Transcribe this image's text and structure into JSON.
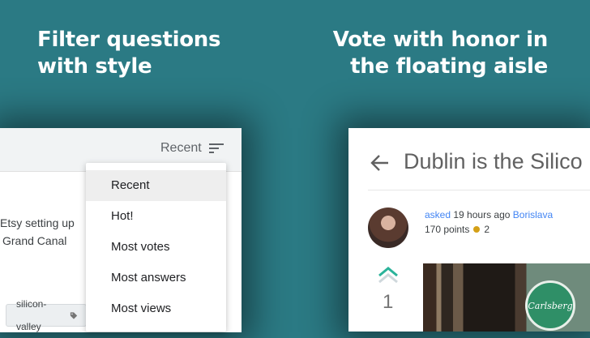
{
  "headlines": {
    "left": [
      "Filter questions",
      "with style"
    ],
    "right": [
      "Vote with honor in",
      "the floating aisle"
    ]
  },
  "filter_card": {
    "sort_label": "Recent",
    "sort_icon": "sort-icon",
    "question_lines": [
      "Etsy setting up",
      "Grand Canal"
    ],
    "tag": {
      "label": "silicon-valley",
      "icon": "tag-icon"
    },
    "dropdown": {
      "selected": "Recent",
      "options": [
        "Recent",
        "Hot!",
        "Most votes",
        "Most answers",
        "Most views"
      ]
    }
  },
  "question_card": {
    "title": "Dublin is the Silico",
    "back_icon": "arrow-back-icon",
    "asked_label": "asked",
    "asked_time": "19 hours ago",
    "author": "Borislava",
    "points": "170 points",
    "badge_count": "2",
    "vote_count": "1",
    "photo_sign_text": "Carlsberg"
  },
  "colors": {
    "background": "#2b7a84",
    "link": "#4285f4",
    "upvote": "#2bb39a",
    "badge": "#d4a017"
  }
}
